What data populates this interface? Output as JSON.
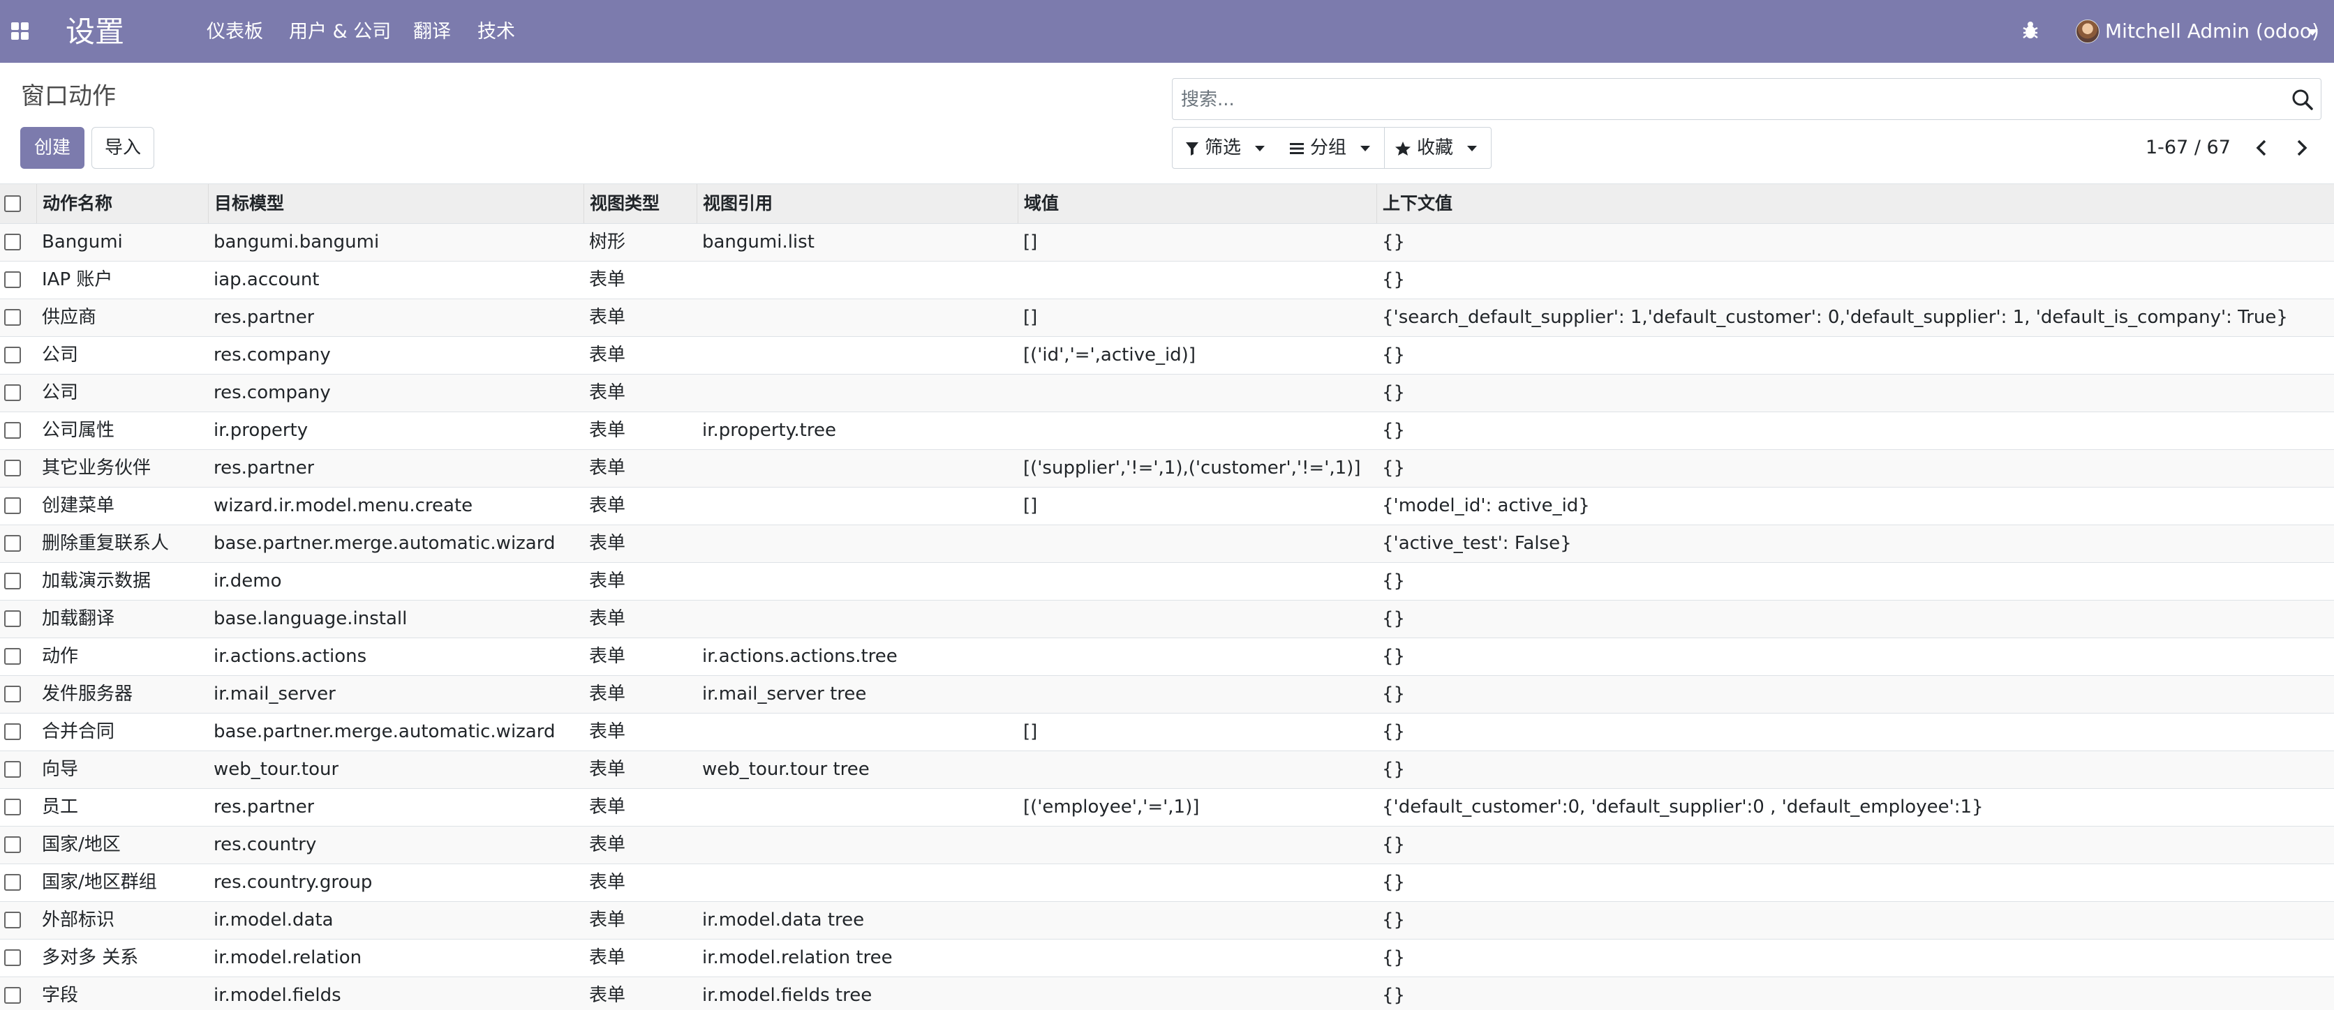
{
  "navbar": {
    "app_title": "设置",
    "menu": [
      "仪表板",
      "用户 & 公司",
      "翻译",
      "技术"
    ],
    "user": "Mitchell Admin (odoo)",
    "bg_color": "#7c7bad"
  },
  "control_panel": {
    "breadcrumb": "窗口动作",
    "create_label": "创建",
    "import_label": "导入",
    "search_placeholder": "搜索...",
    "filter_label": "筛选",
    "group_label": "分组",
    "favorite_label": "收藏",
    "pager": "1-67 / 67"
  },
  "table": {
    "columns": [
      "动作名称",
      "目标模型",
      "视图类型",
      "视图引用",
      "域值",
      "上下文值"
    ],
    "rows": [
      [
        "Bangumi",
        "bangumi.bangumi",
        "树形",
        "bangumi.list",
        "[]",
        "{}"
      ],
      [
        "IAP 账户",
        "iap.account",
        "表单",
        "",
        "",
        "{}"
      ],
      [
        "供应商",
        "res.partner",
        "表单",
        "",
        "[]",
        "{'search_default_supplier': 1,'default_customer': 0,'default_supplier': 1, 'default_is_company': True}"
      ],
      [
        "公司",
        "res.company",
        "表单",
        "",
        "[('id','=',active_id)]",
        "{}"
      ],
      [
        "公司",
        "res.company",
        "表单",
        "",
        "",
        "{}"
      ],
      [
        "公司属性",
        "ir.property",
        "表单",
        "ir.property.tree",
        "",
        "{}"
      ],
      [
        "其它业务伙伴",
        "res.partner",
        "表单",
        "",
        "[('supplier','!=',1),('customer','!=',1)]",
        "{}"
      ],
      [
        "创建菜单",
        "wizard.ir.model.menu.create",
        "表单",
        "",
        "[]",
        "{'model_id': active_id}"
      ],
      [
        "删除重复联系人",
        "base.partner.merge.automatic.wizard",
        "表单",
        "",
        "",
        "{'active_test': False}"
      ],
      [
        "加载演示数据",
        "ir.demo",
        "表单",
        "",
        "",
        "{}"
      ],
      [
        "加载翻译",
        "base.language.install",
        "表单",
        "",
        "",
        "{}"
      ],
      [
        "动作",
        "ir.actions.actions",
        "表单",
        "ir.actions.actions.tree",
        "",
        "{}"
      ],
      [
        "发件服务器",
        "ir.mail_server",
        "表单",
        "ir.mail_server tree",
        "",
        "{}"
      ],
      [
        "合并合同",
        "base.partner.merge.automatic.wizard",
        "表单",
        "",
        "[]",
        "{}"
      ],
      [
        "向导",
        "web_tour.tour",
        "表单",
        "web_tour.tour tree",
        "",
        "{}"
      ],
      [
        "员工",
        "res.partner",
        "表单",
        "",
        "[('employee','=',1)]",
        "{'default_customer':0, 'default_supplier':0 , 'default_employee':1}"
      ],
      [
        "国家/地区",
        "res.country",
        "表单",
        "",
        "",
        "{}"
      ],
      [
        "国家/地区群组",
        "res.country.group",
        "表单",
        "",
        "",
        "{}"
      ],
      [
        "外部标识",
        "ir.model.data",
        "表单",
        "ir.model.data tree",
        "",
        "{}"
      ],
      [
        "多对多 关系",
        "ir.model.relation",
        "表单",
        "ir.model.relation tree",
        "",
        "{}"
      ],
      [
        "字段",
        "ir.model.fields",
        "表单",
        "ir.model.fields tree",
        "",
        "{}"
      ]
    ]
  }
}
